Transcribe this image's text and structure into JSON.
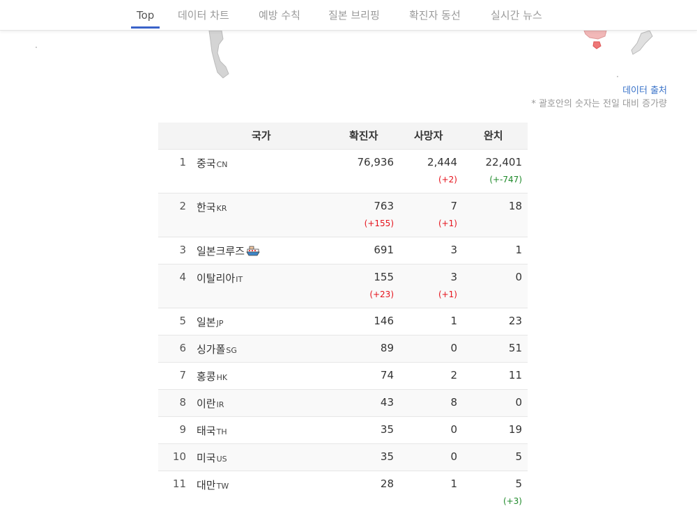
{
  "nav": {
    "tabs": [
      {
        "label": "Top"
      },
      {
        "label": "데이터 차트"
      },
      {
        "label": "예방 수칙"
      },
      {
        "label": "질본 브리핑"
      },
      {
        "label": "확진자 동선"
      },
      {
        "label": "실시간 뉴스"
      }
    ],
    "active_index": 0
  },
  "source": {
    "link_label": "데이터 출처",
    "note": "* 괄호안의 숫자는 전일 대비 증가량"
  },
  "table": {
    "headers": {
      "country": "국가",
      "confirmed": "확진자",
      "deaths": "사망자",
      "recovered": "완치"
    },
    "rows": [
      {
        "rank": "1",
        "name": "중국",
        "code": "CN",
        "confirmed": "76,936",
        "deaths": "2,444",
        "recovered": "22,401",
        "confirmed_delta": "",
        "deaths_delta": "(+2)",
        "recovered_delta": "(+-747)"
      },
      {
        "rank": "2",
        "name": "한국",
        "code": "KR",
        "confirmed": "763",
        "deaths": "7",
        "recovered": "18",
        "confirmed_delta": "(+155)",
        "deaths_delta": "(+1)",
        "recovered_delta": ""
      },
      {
        "rank": "3",
        "name": "일본크루즈",
        "code": "",
        "confirmed": "691",
        "deaths": "3",
        "recovered": "1",
        "confirmed_delta": "",
        "deaths_delta": "",
        "recovered_delta": "",
        "icon": "cruise-ship-icon"
      },
      {
        "rank": "4",
        "name": "이탈리아",
        "code": "IT",
        "confirmed": "155",
        "deaths": "3",
        "recovered": "0",
        "confirmed_delta": "(+23)",
        "deaths_delta": "(+1)",
        "recovered_delta": ""
      },
      {
        "rank": "5",
        "name": "일본",
        "code": "JP",
        "confirmed": "146",
        "deaths": "1",
        "recovered": "23",
        "confirmed_delta": "",
        "deaths_delta": "",
        "recovered_delta": ""
      },
      {
        "rank": "6",
        "name": "싱가폴",
        "code": "SG",
        "confirmed": "89",
        "deaths": "0",
        "recovered": "51",
        "confirmed_delta": "",
        "deaths_delta": "",
        "recovered_delta": ""
      },
      {
        "rank": "7",
        "name": "홍콩",
        "code": "HK",
        "confirmed": "74",
        "deaths": "2",
        "recovered": "11",
        "confirmed_delta": "",
        "deaths_delta": "",
        "recovered_delta": ""
      },
      {
        "rank": "8",
        "name": "이란",
        "code": "IR",
        "confirmed": "43",
        "deaths": "8",
        "recovered": "0",
        "confirmed_delta": "",
        "deaths_delta": "",
        "recovered_delta": ""
      },
      {
        "rank": "9",
        "name": "태국",
        "code": "TH",
        "confirmed": "35",
        "deaths": "0",
        "recovered": "19",
        "confirmed_delta": "",
        "deaths_delta": "",
        "recovered_delta": ""
      },
      {
        "rank": "10",
        "name": "미국",
        "code": "US",
        "confirmed": "35",
        "deaths": "0",
        "recovered": "5",
        "confirmed_delta": "",
        "deaths_delta": "",
        "recovered_delta": ""
      },
      {
        "rank": "11",
        "name": "대만",
        "code": "TW",
        "confirmed": "28",
        "deaths": "1",
        "recovered": "5",
        "confirmed_delta": "",
        "deaths_delta": "",
        "recovered_delta": "(+3)"
      }
    ]
  },
  "colors": {
    "accent": "#3a63c9",
    "link": "#3a73c9",
    "increase": "#e5121b",
    "recovered_increase": "#1f8a2a"
  }
}
